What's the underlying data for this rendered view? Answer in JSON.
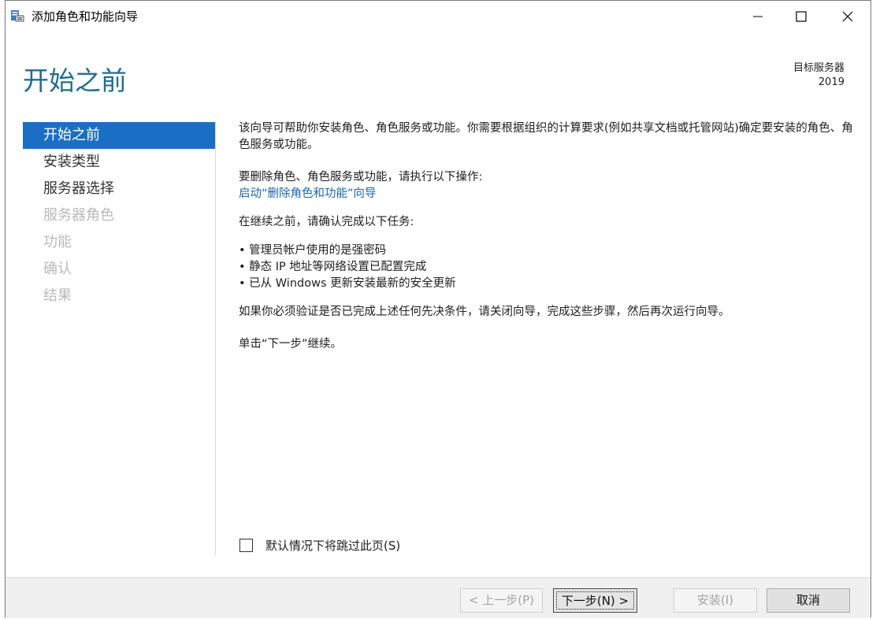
{
  "window": {
    "title": "添加角色和功能向导",
    "icon": "server-manager-icon"
  },
  "header": {
    "page_title": "开始之前",
    "target_label": "目标服务器",
    "target_value": "2019"
  },
  "sidebar": {
    "items": [
      {
        "label": "开始之前",
        "state": "active"
      },
      {
        "label": "安装类型",
        "state": "enabled"
      },
      {
        "label": "服务器选择",
        "state": "enabled"
      },
      {
        "label": "服务器角色",
        "state": "disabled"
      },
      {
        "label": "功能",
        "state": "disabled"
      },
      {
        "label": "确认",
        "state": "disabled"
      },
      {
        "label": "结果",
        "state": "disabled"
      }
    ]
  },
  "content": {
    "intro": "该向导可帮助你安装角色、角色服务或功能。你需要根据组织的计算要求(例如共享文档或托管网站)确定要安装的角色、角色服务或功能。",
    "remove_heading": "要删除角色、角色服务或功能，请执行以下操作:",
    "remove_link": "启动“删除角色和功能”向导",
    "confirm_heading": "在继续之前，请确认完成以下任务:",
    "tasks": [
      "• 管理员帐户使用的是强密码",
      "• 静态 IP 地址等网络设置已配置完成",
      "• 已从 Windows 更新安装最新的安全更新"
    ],
    "verify_note": "如果你必须验证是否已完成上述任何先决条件，请关闭向导，完成这些步骤，然后再次运行向导。",
    "next_note": "单击“下一步”继续。"
  },
  "skip_checkbox": {
    "label": "默认情况下将跳过此页(S)",
    "checked": false
  },
  "footer": {
    "prev_label": "< 上一步(P)",
    "next_label": "下一步(N) >",
    "install_label": "安装(I)",
    "cancel_label": "取消"
  },
  "colors": {
    "title_blue": "#1f6e8c",
    "active_nav": "#1a6fc4",
    "link": "#1766b2",
    "disabled_text": "#b9b9b9"
  }
}
